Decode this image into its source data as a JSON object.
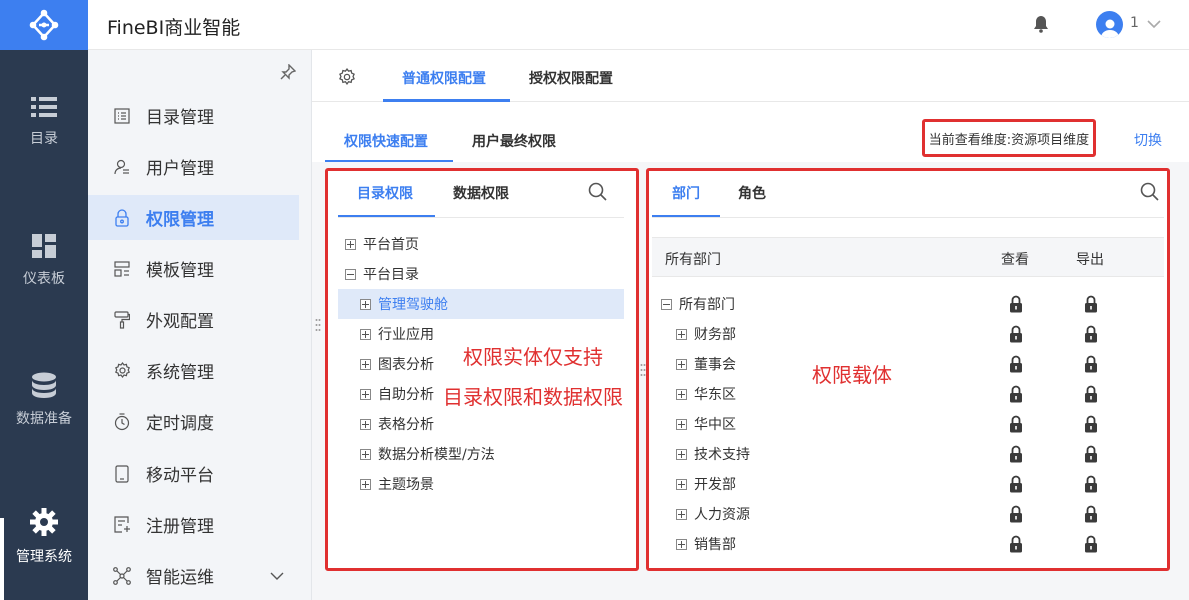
{
  "app": {
    "title": "FineBI商业智能",
    "user": "1",
    "accent": "#3d7ff0"
  },
  "leftnav": [
    {
      "label": "目录",
      "icon": "list-icon"
    },
    {
      "label": "仪表板",
      "icon": "dashboard-icon"
    },
    {
      "label": "数据准备",
      "icon": "database-icon"
    },
    {
      "label": "管理系统",
      "icon": "gear-icon",
      "active": true
    }
  ],
  "submenu": [
    {
      "label": "目录管理",
      "icon": "catalog-icon"
    },
    {
      "label": "用户管理",
      "icon": "user-icon"
    },
    {
      "label": "权限管理",
      "icon": "lock-icon",
      "active": true
    },
    {
      "label": "模板管理",
      "icon": "template-icon"
    },
    {
      "label": "外观配置",
      "icon": "brush-icon"
    },
    {
      "label": "系统管理",
      "icon": "settings-icon"
    },
    {
      "label": "定时调度",
      "icon": "timer-icon"
    },
    {
      "label": "移动平台",
      "icon": "mobile-icon"
    },
    {
      "label": "注册管理",
      "icon": "register-icon"
    },
    {
      "label": "智能运维",
      "icon": "network-icon"
    }
  ],
  "tabs1": [
    "普通权限配置",
    "授权权限配置"
  ],
  "tabs2": [
    "权限快速配置",
    "用户最终权限"
  ],
  "dimension": "当前查看维度:资源项目维度",
  "switch_label": "切换",
  "left_panel": {
    "tabs": [
      "目录权限",
      "数据权限"
    ],
    "tree": [
      {
        "label": "平台首页",
        "level": 0,
        "expanded": false
      },
      {
        "label": "平台目录",
        "level": 0,
        "expanded": true
      },
      {
        "label": "管理驾驶舱",
        "level": 1,
        "expanded": false,
        "selected": true
      },
      {
        "label": "行业应用",
        "level": 1,
        "expanded": false
      },
      {
        "label": "图表分析",
        "level": 1,
        "expanded": false
      },
      {
        "label": "自助分析",
        "level": 1,
        "expanded": false
      },
      {
        "label": "表格分析",
        "level": 1,
        "expanded": false
      },
      {
        "label": "数据分析模型/方法",
        "level": 1,
        "expanded": false
      },
      {
        "label": "主题场景",
        "level": 1,
        "expanded": false
      }
    ],
    "annotation_line1": "权限实体仅支持",
    "annotation_line2": "目录权限和数据权限"
  },
  "right_panel": {
    "tabs": [
      "部门",
      "角色"
    ],
    "columns": [
      "所有部门",
      "查看",
      "导出"
    ],
    "rows": [
      {
        "label": "所有部门",
        "level": 0,
        "expanded": true
      },
      {
        "label": "财务部",
        "level": 1
      },
      {
        "label": "董事会",
        "level": 1
      },
      {
        "label": "华东区",
        "level": 1
      },
      {
        "label": "华中区",
        "level": 1
      },
      {
        "label": "技术支持",
        "level": 1
      },
      {
        "label": "开发部",
        "level": 1
      },
      {
        "label": "人力资源",
        "level": 1
      },
      {
        "label": "销售部",
        "level": 1
      }
    ],
    "annotation": "权限载体"
  }
}
